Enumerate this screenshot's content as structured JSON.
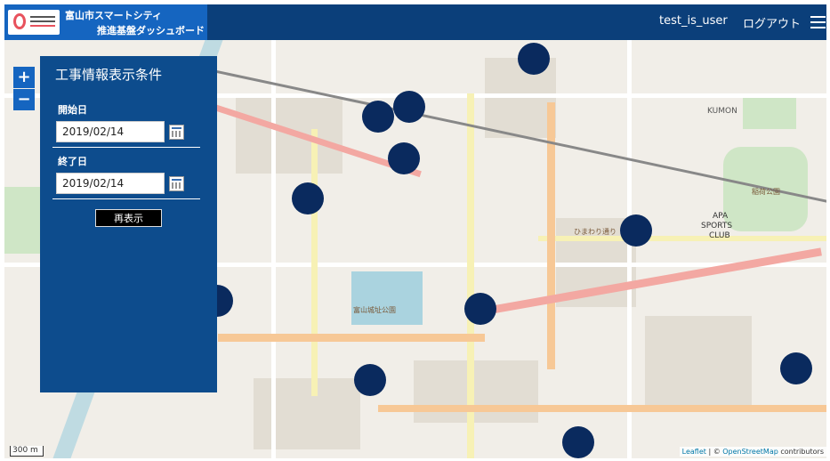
{
  "header": {
    "title_line1": "富山市スマートシティ",
    "title_line2": "推進基盤ダッシュボード",
    "user": "test_is_user",
    "logout_label": "ログアウト",
    "menu_icon": "hamburger-icon",
    "brand_color": "#0b3f7a",
    "logo_color": "#1565c0"
  },
  "map": {
    "zoom_in_label": "+",
    "zoom_out_label": "−",
    "scale_label": "300 m",
    "attribution_leaflet": "Leaflet",
    "attribution_sep": " | © ",
    "attribution_osm": "OpenStreetMap",
    "attribution_tail": " contributors",
    "marker_color": "#0a2a5e",
    "marker_count": 12,
    "places": {
      "kumon": "KUMON",
      "shiroyama_park": "富山城址公園",
      "inari_park": "稲荷公園",
      "apa_club_1": "APA",
      "apa_club_2": "SPORTS",
      "apa_club_3": "CLUB",
      "himawari": "ひまわり通り"
    }
  },
  "filter_panel": {
    "title": "工事情報表示条件",
    "start_label": "開始日",
    "start_value": "2019/02/14",
    "end_label": "終了日",
    "end_value": "2019/02/14",
    "redisplay_label": "再表示",
    "calendar_icon": "calendar-icon"
  }
}
